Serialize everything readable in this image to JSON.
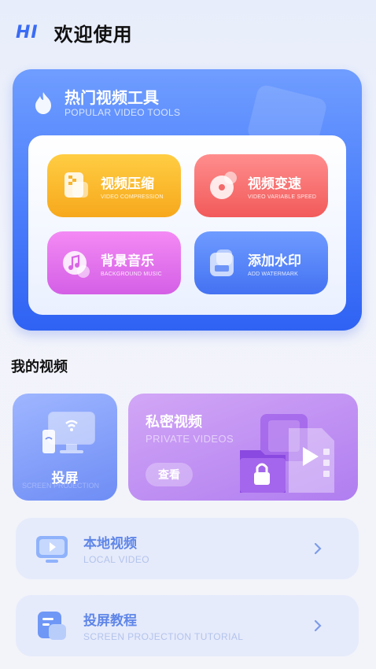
{
  "header": {
    "logo": "HI",
    "title": "欢迎使用"
  },
  "tools": {
    "title": "热门视频工具",
    "subtitle": "POPULAR VIDEO TOOLS",
    "items": [
      {
        "name": "视频压缩",
        "en": "VIDEO COMPRESSION",
        "icon": "compress-file-icon",
        "color": "#f7a81c"
      },
      {
        "name": "视频变速",
        "en": "VIDEO VARIABLE SPEED",
        "icon": "speed-disc-icon",
        "color": "#f25a5a"
      },
      {
        "name": "背景音乐",
        "en": "BACKGROUND MUSIC",
        "icon": "music-note-icon",
        "color": "#d45fe6"
      },
      {
        "name": "添加水印",
        "en": "ADD WATERMARK",
        "icon": "watermark-stamp-icon",
        "color": "#4472f2"
      }
    ]
  },
  "my_videos": {
    "title": "我的视频",
    "cast": {
      "label": "投屏",
      "watermark": "SCREEN PROJECTION",
      "icon": "screen-cast-icon"
    },
    "private": {
      "title": "私密视频",
      "subtitle": "PRIVATE VIDEOS",
      "button": "查看",
      "icon": "locked-folder-video-icon"
    }
  },
  "list": [
    {
      "name": "本地视频",
      "sub": "LOCAL VIDEO",
      "icon": "play-monitor-icon"
    },
    {
      "name": "投屏教程",
      "sub": "SCREEN PROJECTION TUTORIAL",
      "icon": "tutorial-doc-icon"
    }
  ],
  "colors": {
    "accent": "#3a6cf4",
    "tools_card": "#4a7dfb",
    "private_card": "#b07ef0",
    "list_text": "#5f86e8"
  }
}
